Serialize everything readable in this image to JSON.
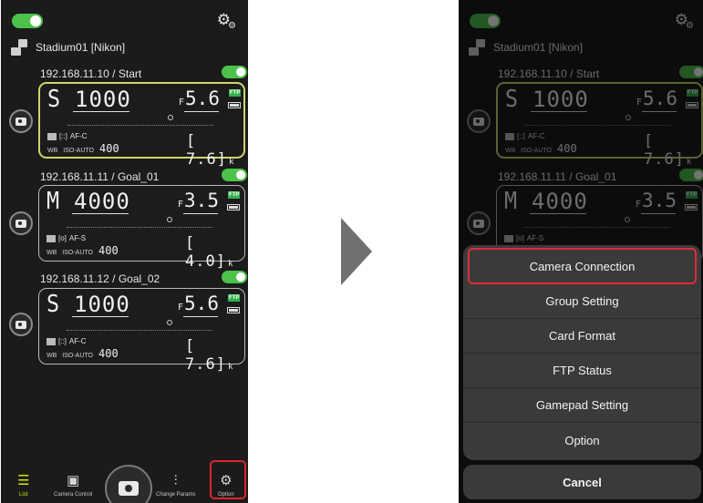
{
  "group": {
    "name": "Stadium01 [Nikon]"
  },
  "cameras": [
    {
      "label": "192.168.11.10 / Start",
      "mode": "S",
      "shutter": "1000",
      "f_prefix": "F",
      "aperture": "5.6",
      "ftp": "FTP",
      "af_mode": "AF-C",
      "iso_prefix": "ISO-AUTO",
      "iso": "400",
      "frames": "7.6",
      "frames_unit": "k"
    },
    {
      "label": "192.168.11.11 / Goal_01",
      "mode": "M",
      "shutter": "4000",
      "f_prefix": "F",
      "aperture": "3.5",
      "ftp": "FTP",
      "af_mode": "AF-S",
      "iso_prefix": "ISO-AUTO",
      "iso": "400",
      "frames": "4.0",
      "frames_unit": "k"
    },
    {
      "label": "192.168.11.12 / Goal_02",
      "mode": "S",
      "shutter": "1000",
      "f_prefix": "F",
      "aperture": "5.6",
      "ftp": "FTP",
      "af_mode": "AF-C",
      "iso_prefix": "ISO-AUTO",
      "iso": "400",
      "frames": "7.6",
      "frames_unit": "k"
    }
  ],
  "tabbar": {
    "list": "List",
    "camera_control": "Camera Control",
    "change_params": "Change Params",
    "option": "Option",
    "active": "list"
  },
  "menu": {
    "items": [
      "Camera Connection",
      "Group Setting",
      "Card Format",
      "FTP Status",
      "Gamepad Setting",
      "Option"
    ],
    "highlighted": "Camera Connection",
    "cancel": "Cancel"
  },
  "colors": {
    "accent": "#4cc24a",
    "highlight": "#d9252f",
    "active_tab": "#d5e600",
    "selected_lcd": "#cfd56c"
  }
}
